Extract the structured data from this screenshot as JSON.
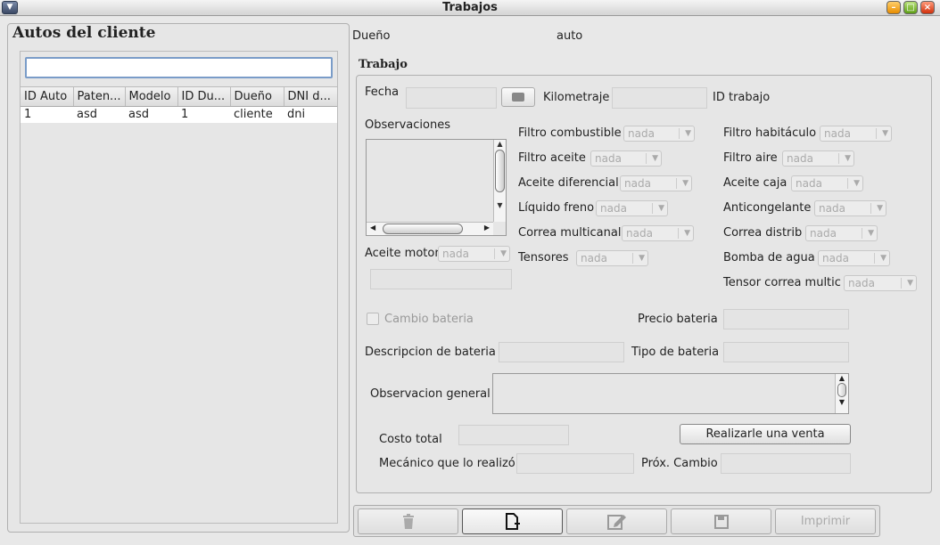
{
  "window": {
    "title": "Trabajos"
  },
  "left": {
    "title": "Autos del cliente",
    "search_value": "",
    "columns": [
      "ID Auto",
      "Paten...",
      "Modelo",
      "ID Du...",
      "Dueño",
      "DNI d..."
    ],
    "rows": [
      [
        "1",
        "asd",
        "asd",
        "1",
        "cliente",
        "dni"
      ]
    ]
  },
  "header": {
    "owner_label": "Dueño",
    "car_label": "auto"
  },
  "trabajo": {
    "title": "Trabajo",
    "fecha_label": "Fecha",
    "kilometraje_label": "Kilometraje",
    "id_trabajo_label": "ID trabajo",
    "observaciones_label": "Observaciones",
    "aceite_motor_label": "Aceite motor",
    "combo_value": "nada",
    "filtros_col1": [
      "Filtro combustible",
      "Filtro aceite",
      "Aceite diferencial",
      "Líquido freno",
      "Correa multicanal",
      "Tensores"
    ],
    "filtros_col2": [
      "Filtro habitáculo",
      "Filtro aire",
      "Aceite caja",
      "Anticongelante",
      "Correa distrib",
      "Bomba de agua",
      "Tensor correa multic"
    ],
    "cambio_bateria_label": "Cambio bateria",
    "precio_bateria_label": "Precio bateria",
    "descripcion_bateria_label": "Descripcion de bateria",
    "tipo_bateria_label": "Tipo de bateria",
    "observacion_general_label": "Observacion general",
    "costo_total_label": "Costo total",
    "venta_button": "Realizarle una venta",
    "mecanico_label": "Mecánico que lo realizó",
    "prox_cambio_label": "Próx. Cambio"
  },
  "toolbar": {
    "imprimir_label": "Imprimir"
  }
}
